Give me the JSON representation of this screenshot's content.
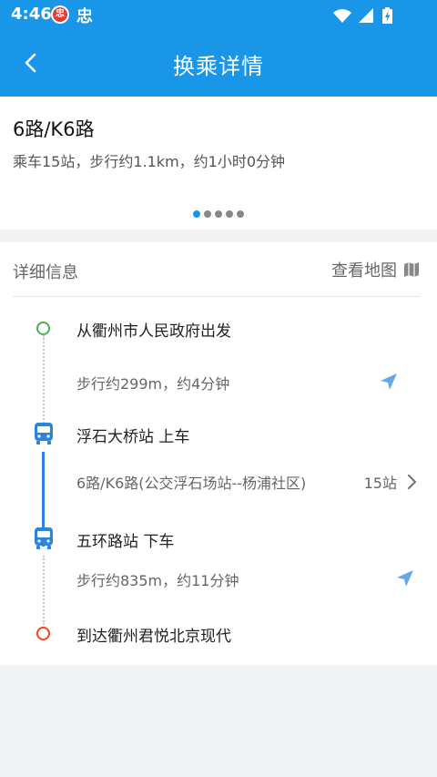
{
  "status_bar": {
    "time": "4:46",
    "app_icon_1_char": "忠",
    "app_icon_2_char": "忠",
    "icons": [
      "wifi-icon",
      "signal-icon",
      "battery-charging-icon"
    ]
  },
  "toolbar": {
    "title": "换乘详情",
    "back_icon": "chevron-left-icon"
  },
  "route": {
    "name": "6路/K6路",
    "summary": "乘车15站，步行约1.1km，约1小时0分钟",
    "pager_count": 5,
    "pager_active_index": 0
  },
  "details": {
    "title": "详细信息",
    "view_map_label": "查看地图",
    "view_map_icon": "map-icon",
    "steps": {
      "start": {
        "title": "从衢州市人民政府出发",
        "icon": "start-circle-icon"
      },
      "walk1": {
        "text": "步行约299m，约4分钟",
        "icon": "navigation-arrow-icon"
      },
      "board": {
        "title": "浮石大桥站 上车",
        "icon": "bus-icon"
      },
      "ride": {
        "text": "6路/K6路(公交浮石场站--杨浦社区)",
        "stops": "15站",
        "icon": "chevron-right-icon"
      },
      "alight": {
        "title": "五环路站 下车",
        "icon": "bus-icon"
      },
      "walk2": {
        "text": "步行约835m，约11分钟",
        "icon": "navigation-arrow-icon"
      },
      "end": {
        "title": "到达衢州君悦北京现代",
        "icon": "end-circle-icon"
      }
    }
  },
  "colors": {
    "primary": "#1a96e8",
    "route_line": "#2a86dc",
    "start": "#4caf50",
    "end": "#e64a19",
    "nav_arrow": "#64a8ea"
  }
}
